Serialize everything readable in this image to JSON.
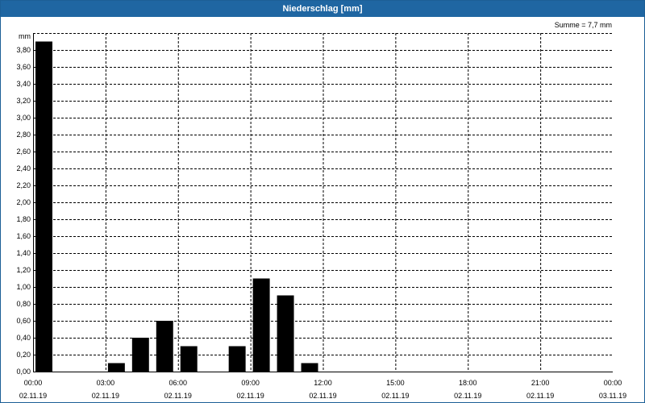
{
  "window": {
    "title": "Niederschlag [mm]"
  },
  "summary": {
    "text": "Summe = 7,7 mm"
  },
  "chart_data": {
    "type": "bar",
    "title": "Niederschlag [mm]",
    "ylabel": "mm",
    "xlabel": "",
    "ylim": [
      0,
      4.0
    ],
    "yticks": [
      "0,00",
      "0,20",
      "0,40",
      "0,60",
      "0,80",
      "1,00",
      "1,20",
      "1,40",
      "1,60",
      "1,80",
      "2,00",
      "2,20",
      "2,40",
      "2,60",
      "2,80",
      "3,00",
      "3,20",
      "3,40",
      "3,60",
      "3,80"
    ],
    "xlim_hours": [
      0,
      24
    ],
    "xticks": [
      {
        "time": "00:00",
        "date": "02.11.19"
      },
      {
        "time": "03:00",
        "date": "02.11.19"
      },
      {
        "time": "06:00",
        "date": "02.11.19"
      },
      {
        "time": "09:00",
        "date": "02.11.19"
      },
      {
        "time": "12:00",
        "date": "02.11.19"
      },
      {
        "time": "15:00",
        "date": "02.11.19"
      },
      {
        "time": "18:00",
        "date": "02.11.19"
      },
      {
        "time": "21:00",
        "date": "02.11.19"
      },
      {
        "time": "00:00",
        "date": "03.11.19"
      }
    ],
    "categories": [
      "00:00",
      "01:00",
      "02:00",
      "03:00",
      "04:00",
      "05:00",
      "06:00",
      "07:00",
      "08:00",
      "09:00",
      "10:00",
      "11:00",
      "12:00",
      "13:00",
      "14:00",
      "15:00",
      "16:00",
      "17:00",
      "18:00",
      "19:00",
      "20:00",
      "21:00",
      "22:00",
      "23:00"
    ],
    "values": [
      3.9,
      0,
      0,
      0.1,
      0.4,
      0.6,
      0.3,
      0,
      0.3,
      1.1,
      0.9,
      0.1,
      0,
      0,
      0,
      0,
      0,
      0,
      0,
      0,
      0,
      0,
      0,
      0
    ],
    "total": "7,7 mm",
    "grid": true,
    "colors": {
      "bar": "#000000",
      "grid": "#000000",
      "title_bar": "#1f66a2"
    }
  }
}
